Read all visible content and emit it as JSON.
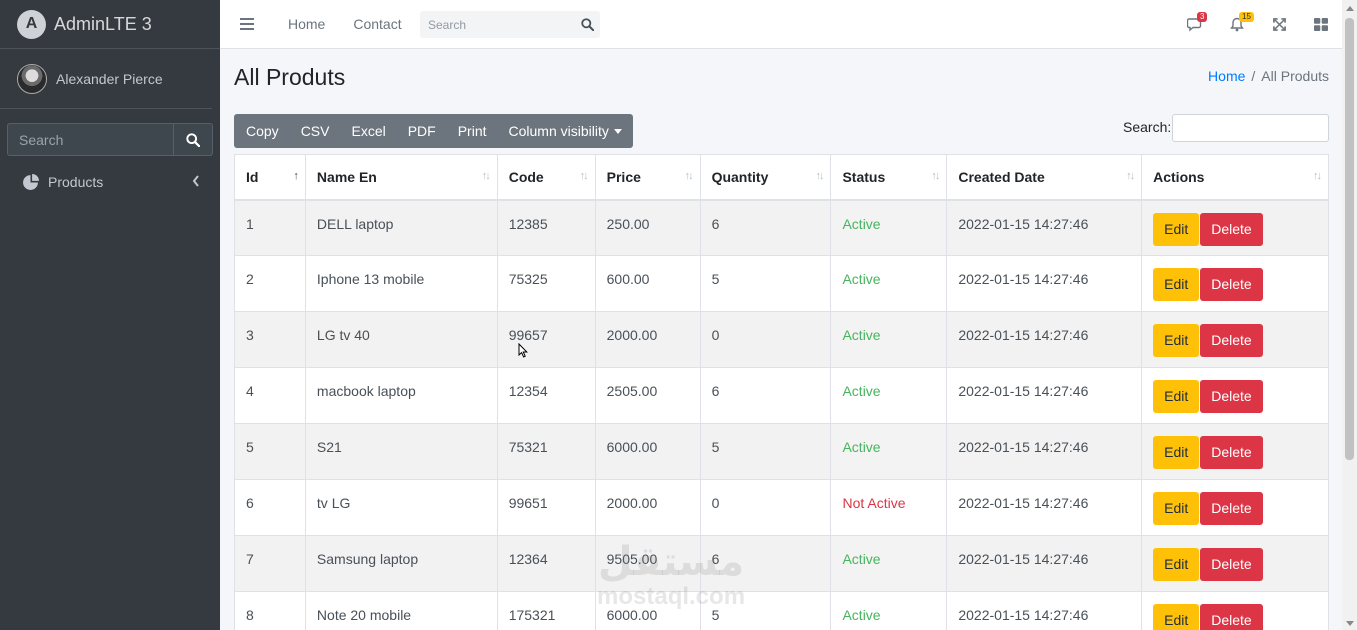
{
  "brand": {
    "name": "AdminLTE 3"
  },
  "user": {
    "name": "Alexander Pierce"
  },
  "sidebar": {
    "search_placeholder": "Search",
    "items": [
      {
        "label": "Products"
      }
    ]
  },
  "navbar": {
    "links": [
      "Home",
      "Contact"
    ],
    "search_placeholder": "Search",
    "messages_badge": "3",
    "notifications_badge": "15"
  },
  "page": {
    "title": "All Produts"
  },
  "breadcrumb": {
    "home": "Home",
    "separator": "/",
    "current": "All Produts"
  },
  "toolbar": {
    "buttons": [
      "Copy",
      "CSV",
      "Excel",
      "PDF",
      "Print",
      "Column visibility"
    ],
    "search_label": "Search:"
  },
  "table": {
    "headers": [
      "Id",
      "Name En",
      "Code",
      "Price",
      "Quantity",
      "Status",
      "Created Date",
      "Actions"
    ],
    "sort_asc_icon": "↑",
    "sort_icon": "↑↓",
    "edit_label": "Edit",
    "delete_label": "Delete",
    "rows": [
      {
        "id": "1",
        "name": "DELL laptop",
        "code": "12385",
        "price": "250.00",
        "quantity": "6",
        "status": "Active",
        "created": "2022-01-15 14:27:46"
      },
      {
        "id": "2",
        "name": "Iphone 13 mobile",
        "code": "75325",
        "price": "600.00",
        "quantity": "5",
        "status": "Active",
        "created": "2022-01-15 14:27:46"
      },
      {
        "id": "3",
        "name": "LG tv 40",
        "code": "99657",
        "price": "2000.00",
        "quantity": "0",
        "status": "Active",
        "created": "2022-01-15 14:27:46"
      },
      {
        "id": "4",
        "name": "macbook laptop",
        "code": "12354",
        "price": "2505.00",
        "quantity": "6",
        "status": "Active",
        "created": "2022-01-15 14:27:46"
      },
      {
        "id": "5",
        "name": "S21",
        "code": "75321",
        "price": "6000.00",
        "quantity": "5",
        "status": "Active",
        "created": "2022-01-15 14:27:46"
      },
      {
        "id": "6",
        "name": "tv LG",
        "code": "99651",
        "price": "2000.00",
        "quantity": "0",
        "status": "Not Active",
        "created": "2022-01-15 14:27:46"
      },
      {
        "id": "7",
        "name": "Samsung laptop",
        "code": "12364",
        "price": "9505.00",
        "quantity": "6",
        "status": "Active",
        "created": "2022-01-15 14:27:46"
      },
      {
        "id": "8",
        "name": "Note 20 mobile",
        "code": "175321",
        "price": "6000.00",
        "quantity": "5",
        "status": "Active",
        "created": "2022-01-15 14:27:46"
      }
    ]
  },
  "watermark": {
    "line1": "مستقل",
    "line2": "mostaql.com"
  },
  "colors": {
    "sidebar_bg": "#343a40",
    "edit": "#ffc107",
    "delete": "#dc3545",
    "active": "#28a745",
    "link": "#007bff"
  }
}
